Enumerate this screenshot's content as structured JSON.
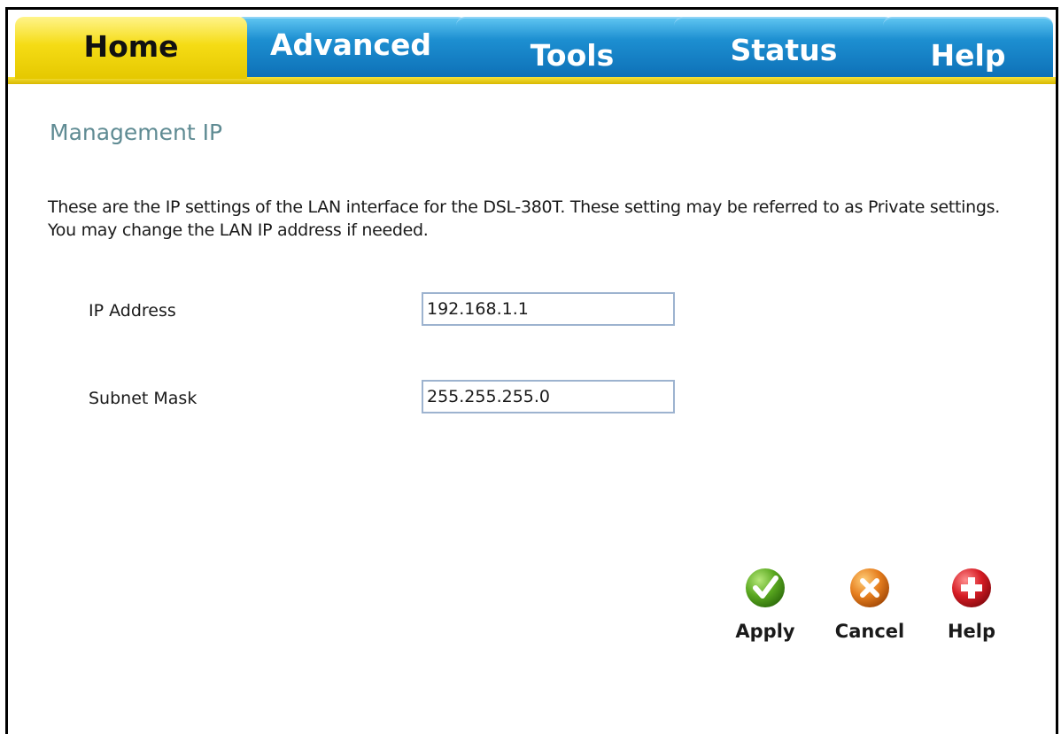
{
  "tabs": [
    {
      "label": "Home",
      "active": true
    },
    {
      "label": "Advanced",
      "active": false
    },
    {
      "label": "Tools",
      "active": false
    },
    {
      "label": "Status",
      "active": false
    },
    {
      "label": "Help",
      "active": false
    }
  ],
  "page": {
    "title": "Management IP",
    "description": "These are the IP settings of the LAN interface for the DSL-380T. These setting may be referred to as Private settings. You may change the LAN IP address if needed."
  },
  "form": {
    "ip_address": {
      "label": "IP Address",
      "value": "192.168.1.1"
    },
    "subnet_mask": {
      "label": "Subnet Mask",
      "value": "255.255.255.0"
    }
  },
  "actions": {
    "apply": {
      "label": "Apply",
      "icon": "check-icon",
      "color": "#5aa820"
    },
    "cancel": {
      "label": "Cancel",
      "icon": "x-icon",
      "color": "#e67e1e"
    },
    "help": {
      "label": "Help",
      "icon": "plus-icon",
      "color": "#d61c24"
    }
  },
  "colors": {
    "active_tab": "#f5dc15",
    "inactive_tab": "#1d8fd1",
    "title_color": "#5f8b93"
  }
}
